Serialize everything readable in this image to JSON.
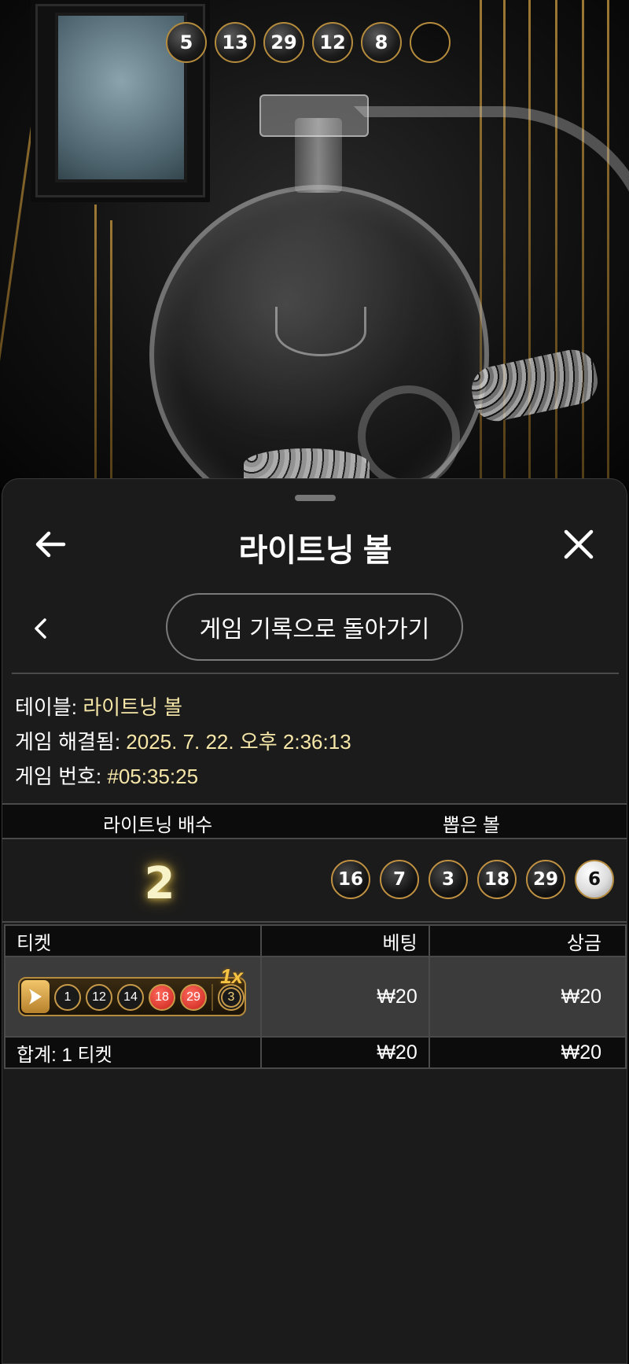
{
  "stage": {
    "drawn_balls": [
      "5",
      "13",
      "29",
      "12",
      "8",
      ""
    ]
  },
  "sheet": {
    "title": "라이트닝 볼",
    "back_to_history_label": "게임 기록으로 돌아가기",
    "info": {
      "table_label": "테이블: ",
      "table_value": "라이트닝 볼",
      "resolved_label": "게임 해결됨: ",
      "resolved_value": "2025. 7. 22. 오후 2:36:13",
      "game_no_label": "게임 번호: ",
      "game_no_value": "#05:35:25"
    },
    "result": {
      "multiplier_header": "라이트닝 배수",
      "drawn_header": "뽑은 볼",
      "multiplier_value": "2",
      "balls": [
        "16",
        "7",
        "3",
        "18",
        "29"
      ],
      "bonus_ball": "6"
    },
    "tickets": {
      "headers": {
        "ticket": "티켓",
        "bet": "베팅",
        "payout": "상금"
      },
      "rows": [
        {
          "numbers": [
            "1",
            "12",
            "14",
            "18",
            "29"
          ],
          "hits": [
            false,
            false,
            false,
            true,
            true
          ],
          "bonus": "3",
          "multiplier": "1x",
          "bet": "₩20",
          "payout": "₩20"
        }
      ],
      "total": {
        "label": "합계: 1 티켓",
        "bet": "₩20",
        "payout": "₩20"
      }
    }
  },
  "colors": {
    "accent_gold": "#c09142",
    "info_value": "#f6e7a8",
    "hit_red": "#c9221a",
    "sheet_bg": "#1b1b1b"
  },
  "icons": {
    "back": "arrow-left-icon",
    "close": "close-icon",
    "chevron": "chevron-left-icon",
    "ticket_play": "play-arrow-icon"
  }
}
